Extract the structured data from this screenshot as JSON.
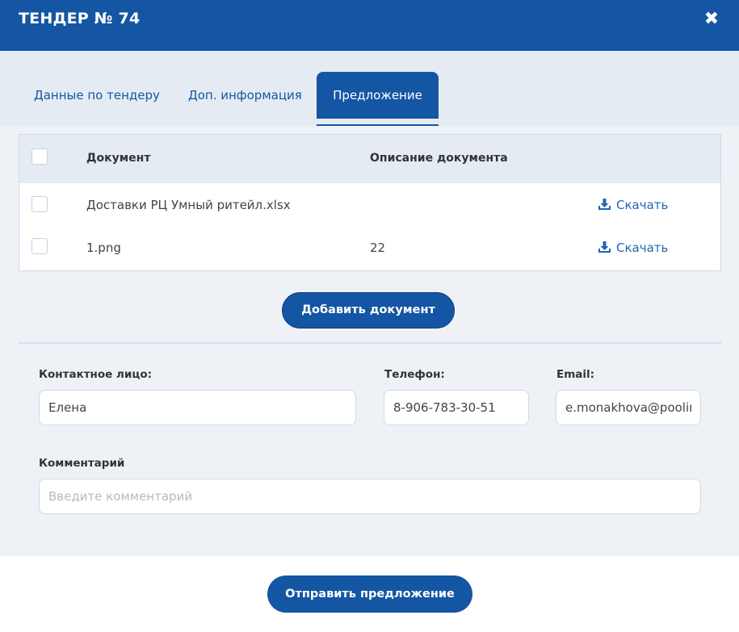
{
  "header": {
    "title": "ТЕНДЕР № 74",
    "close_icon": "close-icon"
  },
  "tabs": [
    {
      "label": "Данные по тендеру",
      "active": false
    },
    {
      "label": "Доп. информация",
      "active": false
    },
    {
      "label": "Предложение",
      "active": true
    }
  ],
  "documents": {
    "columns": [
      "Документ",
      "Описание документа"
    ],
    "rows": [
      {
        "name": "Доставки РЦ Умный ритейл.xlsx",
        "description": "",
        "action": "Скачать"
      },
      {
        "name": "1.png",
        "description": "22",
        "action": "Скачать"
      }
    ],
    "download_icon": "download-icon"
  },
  "add_document_label": "Добавить документ",
  "form": {
    "contact_label": "Контактное лицо:",
    "contact_value": "Елена",
    "phone_label": "Телефон:",
    "phone_value": "8-906-783-30-51",
    "email_label": "Email:",
    "email_value": "e.monakhova@poolir",
    "comment_label": "Комментарий",
    "comment_placeholder": "Введите комментарий"
  },
  "submit_label": "Отправить предложение",
  "colors": {
    "primary": "#1456a3",
    "link": "#1f66b3",
    "panel": "#eef2f7",
    "tab_bar": "#e4ebf3"
  }
}
